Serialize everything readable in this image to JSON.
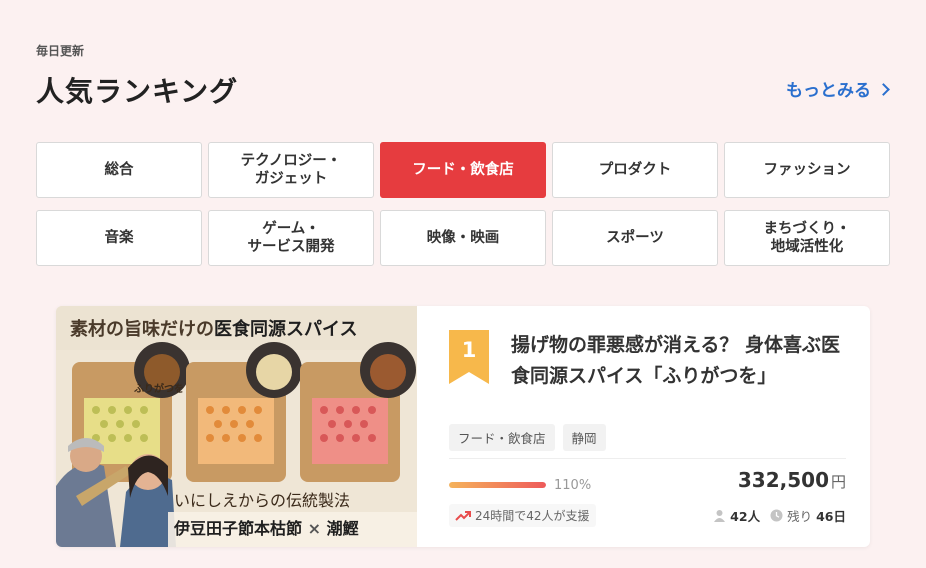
{
  "header": {
    "eyebrow": "毎日更新",
    "title": "人気ランキング",
    "more_label": "もっとみる"
  },
  "categories": [
    {
      "label": "総合",
      "active": false
    },
    {
      "label": "テクノロジー・\nガジェット",
      "active": false
    },
    {
      "label": "フード・飲食店",
      "active": true
    },
    {
      "label": "プロダクト",
      "active": false
    },
    {
      "label": "ファッション",
      "active": false
    },
    {
      "label": "音楽",
      "active": false
    },
    {
      "label": "ゲーム・\nサービス開発",
      "active": false
    },
    {
      "label": "映像・映画",
      "active": false
    },
    {
      "label": "スポーツ",
      "active": false
    },
    {
      "label": "まちづくり・\n地域活性化",
      "active": false
    }
  ],
  "ranking": [
    {
      "rank": "1",
      "title": "揚げ物の罪悪感が消える？ 身体喜ぶ医食同源スパイス「ふりがつを」",
      "tags": [
        "フード・飲食店",
        "静岡"
      ],
      "progress_percent": 110,
      "progress_label": "110%",
      "amount": "332,500",
      "currency": "円",
      "supporters_text": "24時間で42人が支援",
      "backers": "42人",
      "remaining_label": "残り",
      "remaining_value": "46日",
      "thumbnail": {
        "headline_pre": "素材の旨味だけの",
        "headline_em": "医食同源スパイス",
        "package_label": "ふりがつを",
        "sub": "いにしえからの伝統製法",
        "bottom_pre": "伊豆田子節本枯節",
        "bottom_x": "×",
        "bottom_post": "潮鰹"
      }
    }
  ],
  "colors": {
    "background": "#fcf1f1",
    "accent_red": "#e63c3f",
    "link_blue": "#2a6fce",
    "rank_badge": "#f7b84b"
  },
  "icons": {
    "more": "chevron-right-icon",
    "trend": "trending-up-icon",
    "backers": "person-icon",
    "remaining": "clock-icon"
  }
}
